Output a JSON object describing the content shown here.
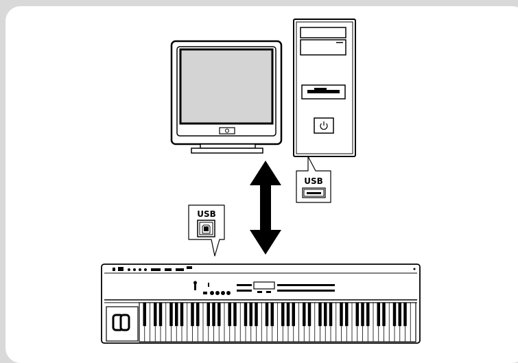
{
  "callouts": {
    "computer_port_label": "USB",
    "instrument_port_label": "USB"
  },
  "icons": {
    "monitor": "monitor-icon",
    "computer": "computer-tower-icon",
    "keyboard": "digital-piano-icon",
    "arrow": "double-arrow-icon",
    "port_a": "usb-type-a-icon",
    "port_b": "usb-type-b-icon"
  },
  "colors": {
    "background": "#d9d9d9",
    "panel": "#ffffff",
    "screen": "#d4d4d4",
    "outline": "#000000"
  }
}
